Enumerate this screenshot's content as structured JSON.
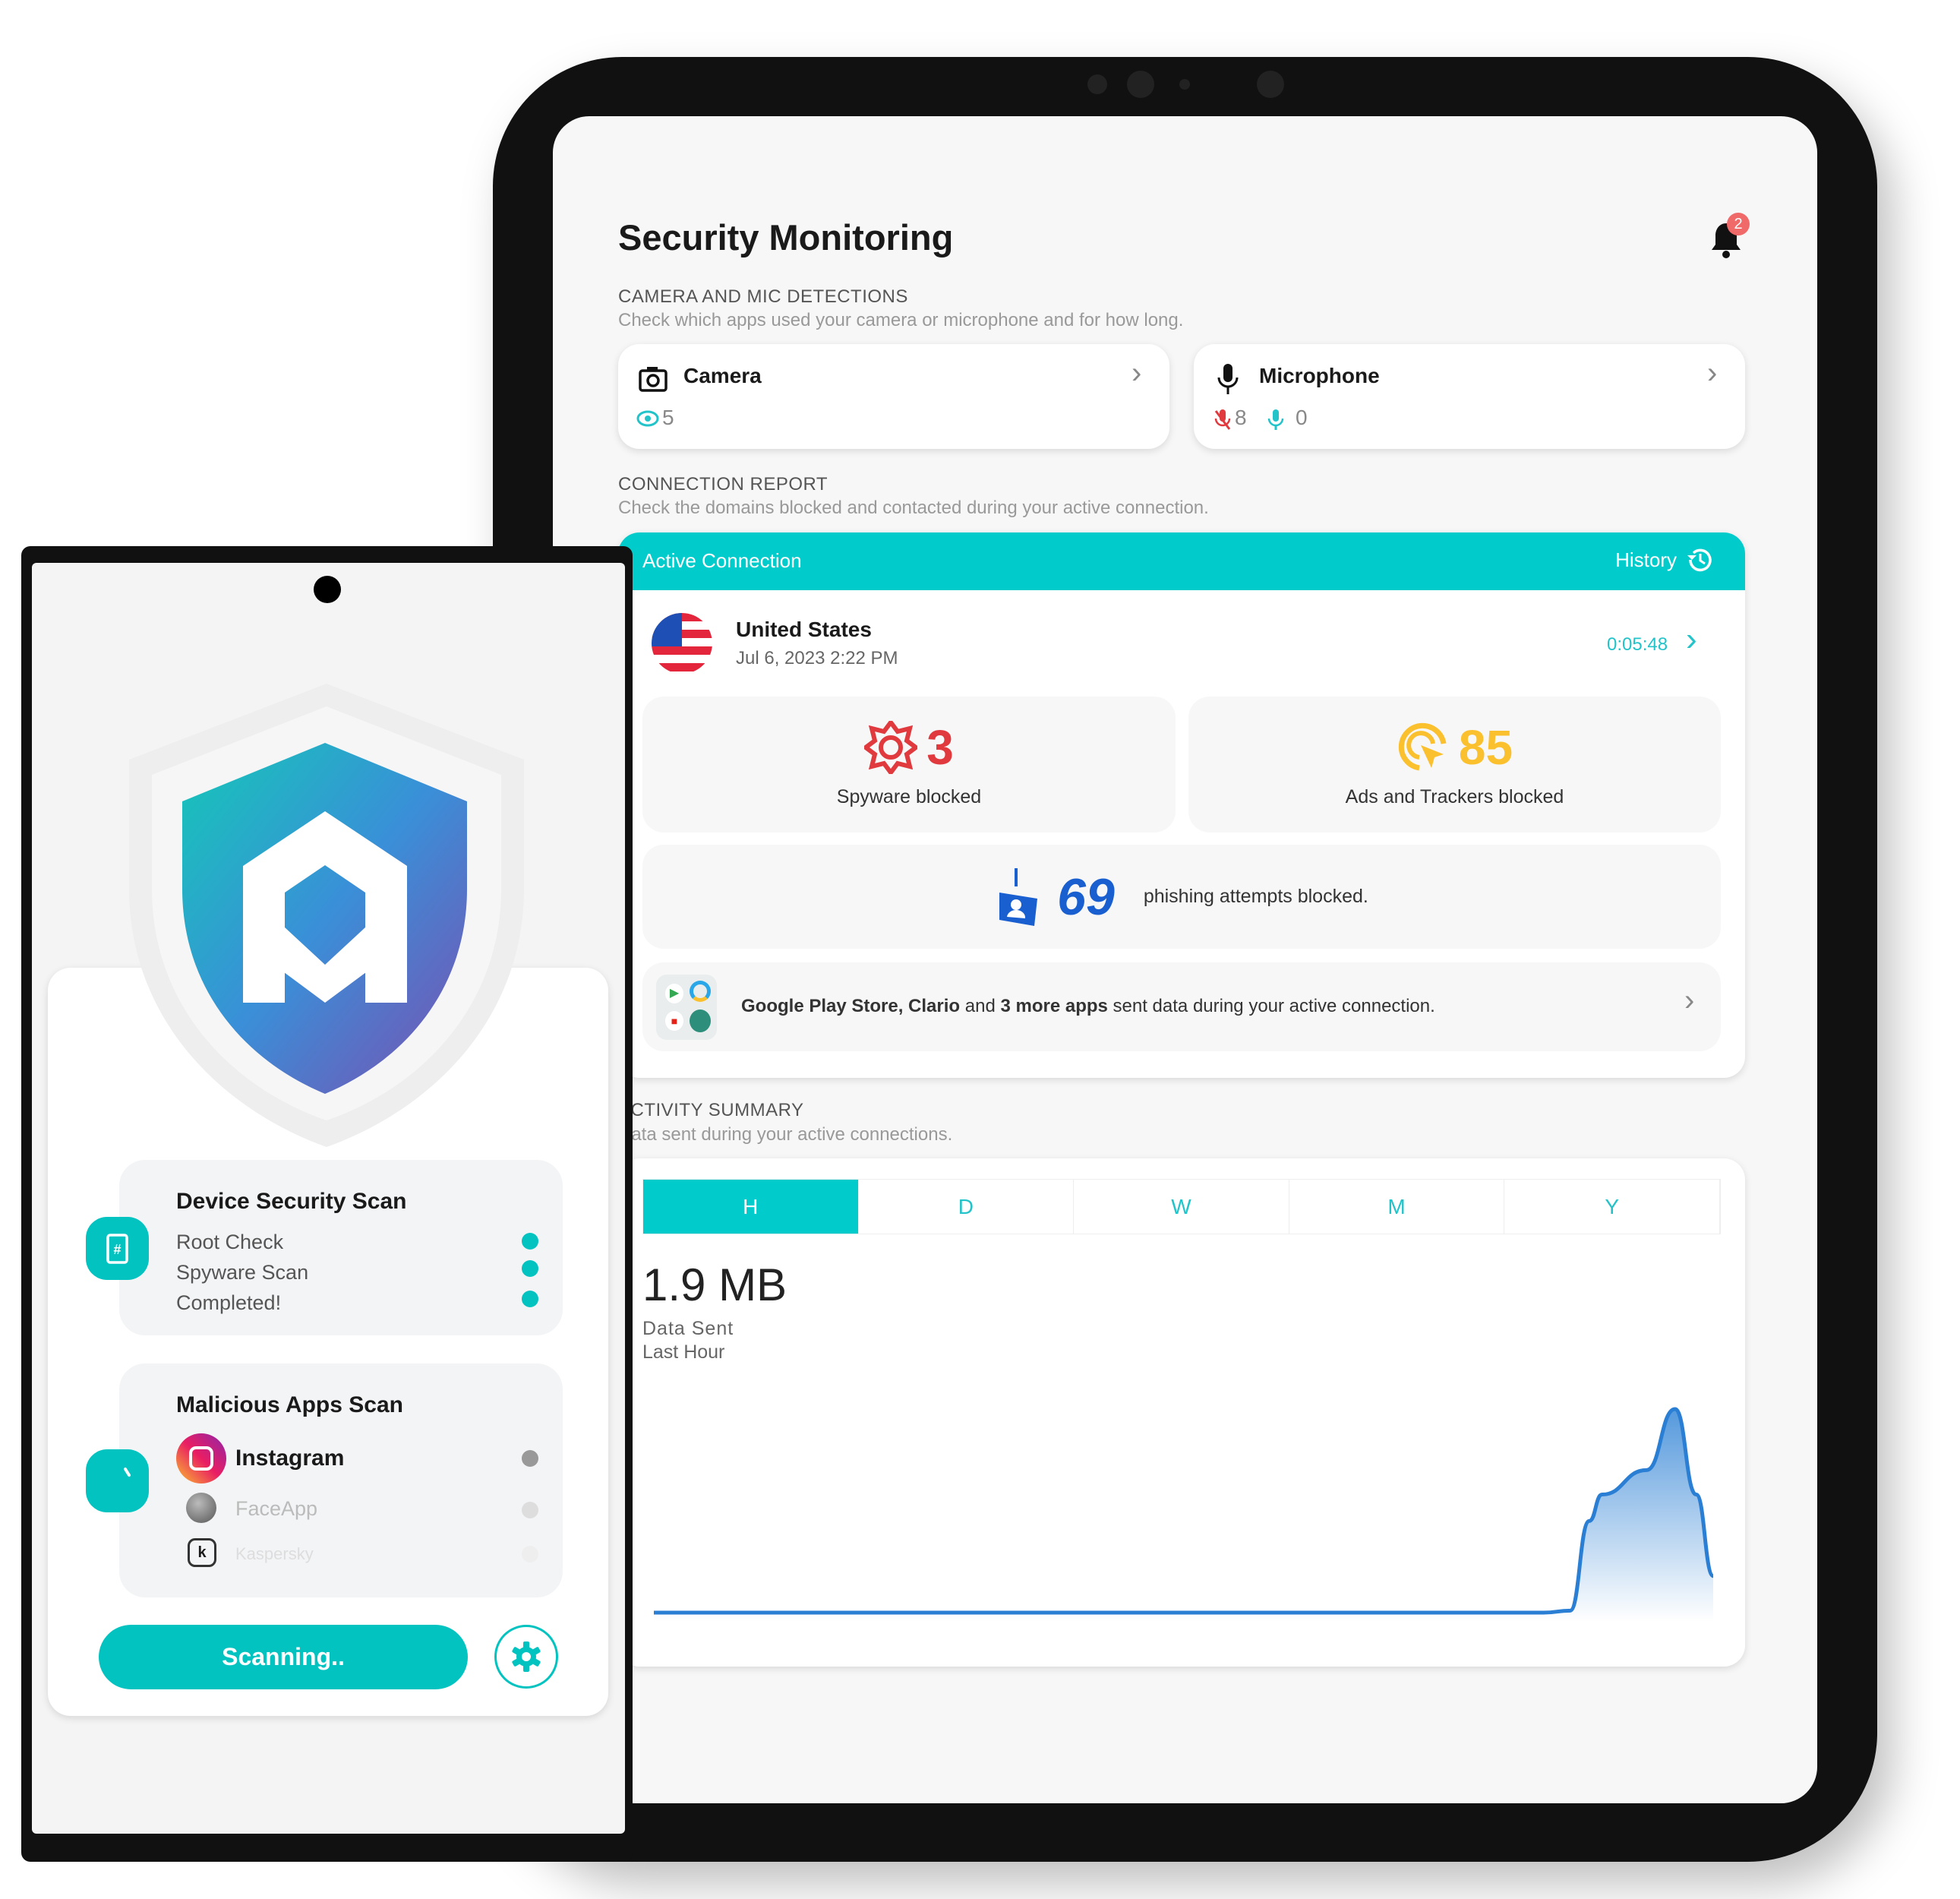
{
  "tablet": {
    "title": "Security Monitoring",
    "notification_count": "2",
    "camera_mic": {
      "label": "CAMERA AND MIC DETECTIONS",
      "subtitle": "Check which apps used your camera or microphone and for how long.",
      "camera": {
        "label": "Camera",
        "views": "5"
      },
      "microphone": {
        "label": "Microphone",
        "muted": "8",
        "active": "0"
      }
    },
    "connection": {
      "label": "CONNECTION REPORT",
      "subtitle": "Check the domains blocked and contacted during your active connection.",
      "header": "Active Connection",
      "history": "History",
      "country": "United States",
      "date": "Jul 6, 2023 2:22 PM",
      "duration": "0:05:48",
      "spyware_count": "3",
      "spyware_label": "Spyware blocked",
      "ads_count": "85",
      "ads_label": "Ads and Trackers blocked",
      "phishing_count": "69",
      "phishing_label": "phishing attempts blocked.",
      "apps_bold1": "Google Play Store, Clario",
      "apps_mid": " and ",
      "apps_bold2": "3 more apps",
      "apps_rest": " sent data during your active connection."
    },
    "activity": {
      "label": "ACTIVITY SUMMARY",
      "subtitle": "Data sent during your active connections.",
      "tabs": [
        "H",
        "D",
        "W",
        "M",
        "Y"
      ],
      "active_tab": "H",
      "value": "1.9 MB",
      "value_label": "Data Sent",
      "period": "Last Hour"
    }
  },
  "phone": {
    "device_scan": {
      "title": "Device Security Scan",
      "items": [
        "Root Check",
        "Spyware Scan",
        "Completed!"
      ]
    },
    "malicious_scan": {
      "title": "Malicious Apps Scan",
      "apps": [
        "Instagram",
        "FaceApp",
        "Kaspersky"
      ]
    },
    "scan_button": "Scanning.."
  },
  "colors": {
    "accent": "#02cccb",
    "spyware": "#e03a3e",
    "ads": "#fbc02d",
    "phishing": "#1a5fd0",
    "chart": "#2a7fd4"
  },
  "chart_data": {
    "type": "area",
    "title": "",
    "xlabel": "",
    "ylabel": "",
    "grid": false,
    "points": [
      [
        0,
        0
      ],
      [
        0.84,
        0
      ],
      [
        0.865,
        0.01
      ],
      [
        0.883,
        0.45
      ],
      [
        0.895,
        0.58
      ],
      [
        0.937,
        0.7
      ],
      [
        0.964,
        1.0
      ],
      [
        0.984,
        0.58
      ],
      [
        1.0,
        0.18
      ]
    ]
  }
}
